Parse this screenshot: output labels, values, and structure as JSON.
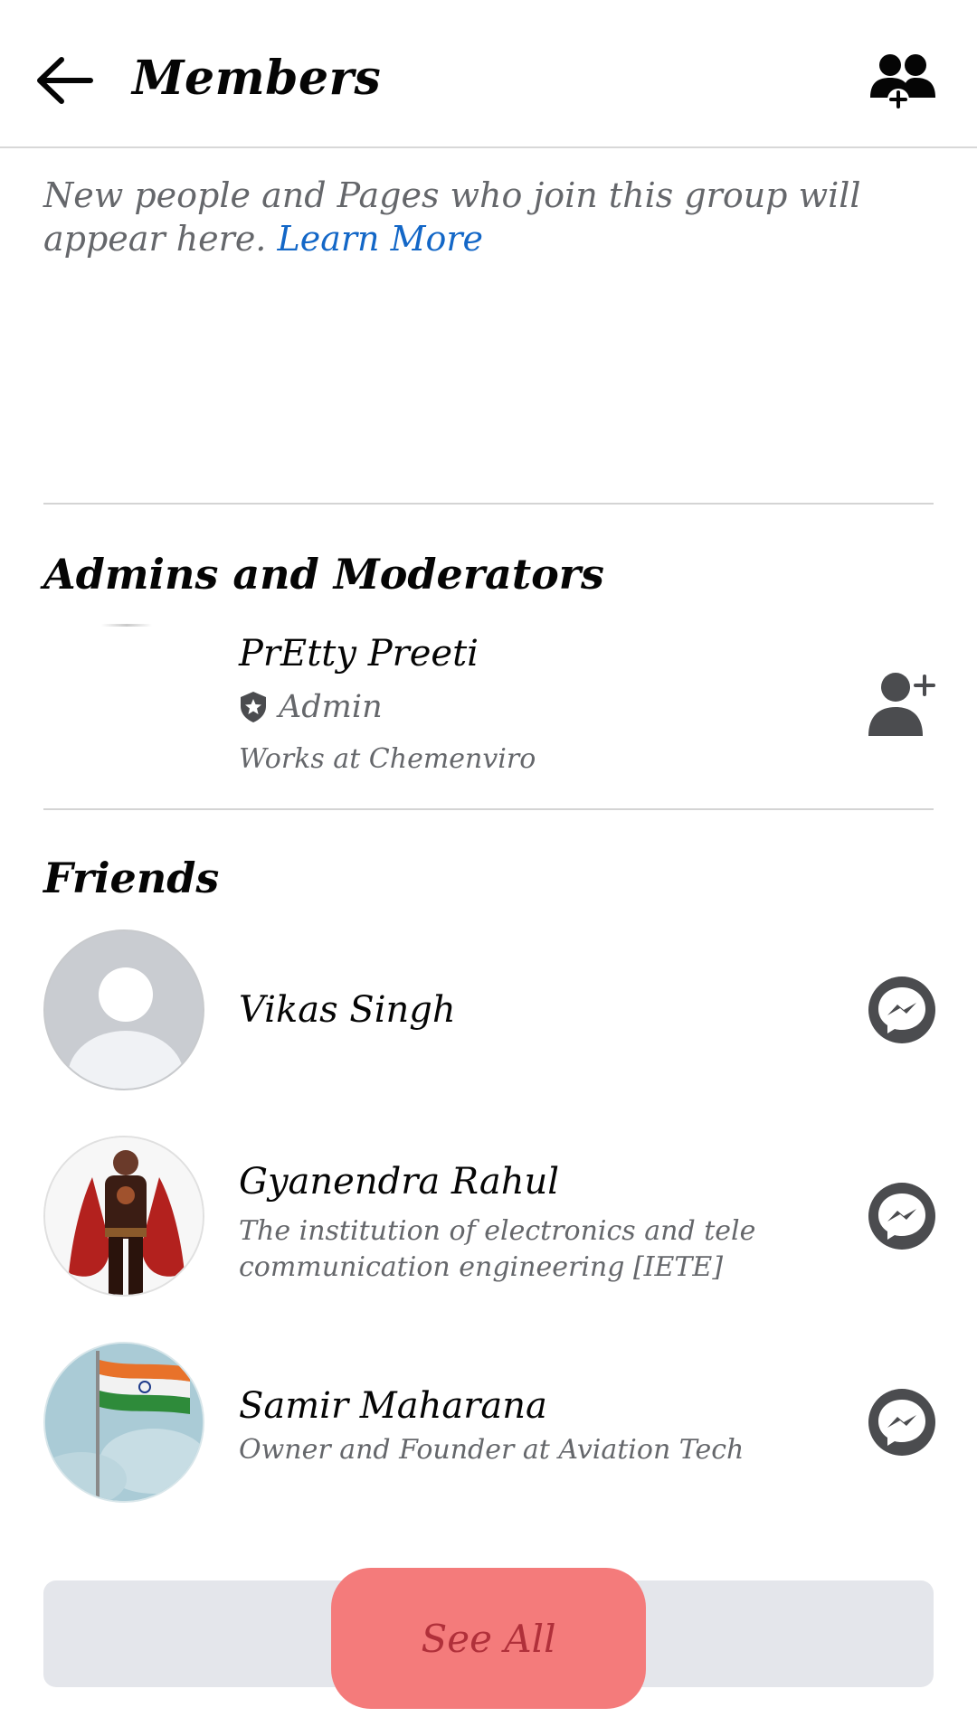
{
  "header": {
    "title": "Members"
  },
  "info": {
    "text": "New people and Pages who join this group will appear here. ",
    "link": "Learn More"
  },
  "admins": {
    "title": "Admins and Moderators",
    "items": [
      {
        "name": "PrEtty Preeti",
        "role": "Admin",
        "work": "Works at Chemenviro"
      }
    ]
  },
  "friends": {
    "title": "Friends",
    "items": [
      {
        "name": "Vikas Singh",
        "subtitle": ""
      },
      {
        "name": "Gyanendra Rahul",
        "subtitle": "The institution of electronics and tele communication engineering [IETE]"
      },
      {
        "name": "Samir Maharana",
        "subtitle": "Owner and Founder at Aviation Tech"
      }
    ]
  },
  "see_all": {
    "label": "See All"
  },
  "colors": {
    "link": "#1367c7",
    "secondary_text": "#65676b",
    "highlight": "#f47b7b",
    "button_bg": "#e4e6eb"
  },
  "icons": [
    "back-arrow-icon",
    "invite-members-icon",
    "admin-shield-icon",
    "add-friend-icon",
    "messenger-icon"
  ]
}
